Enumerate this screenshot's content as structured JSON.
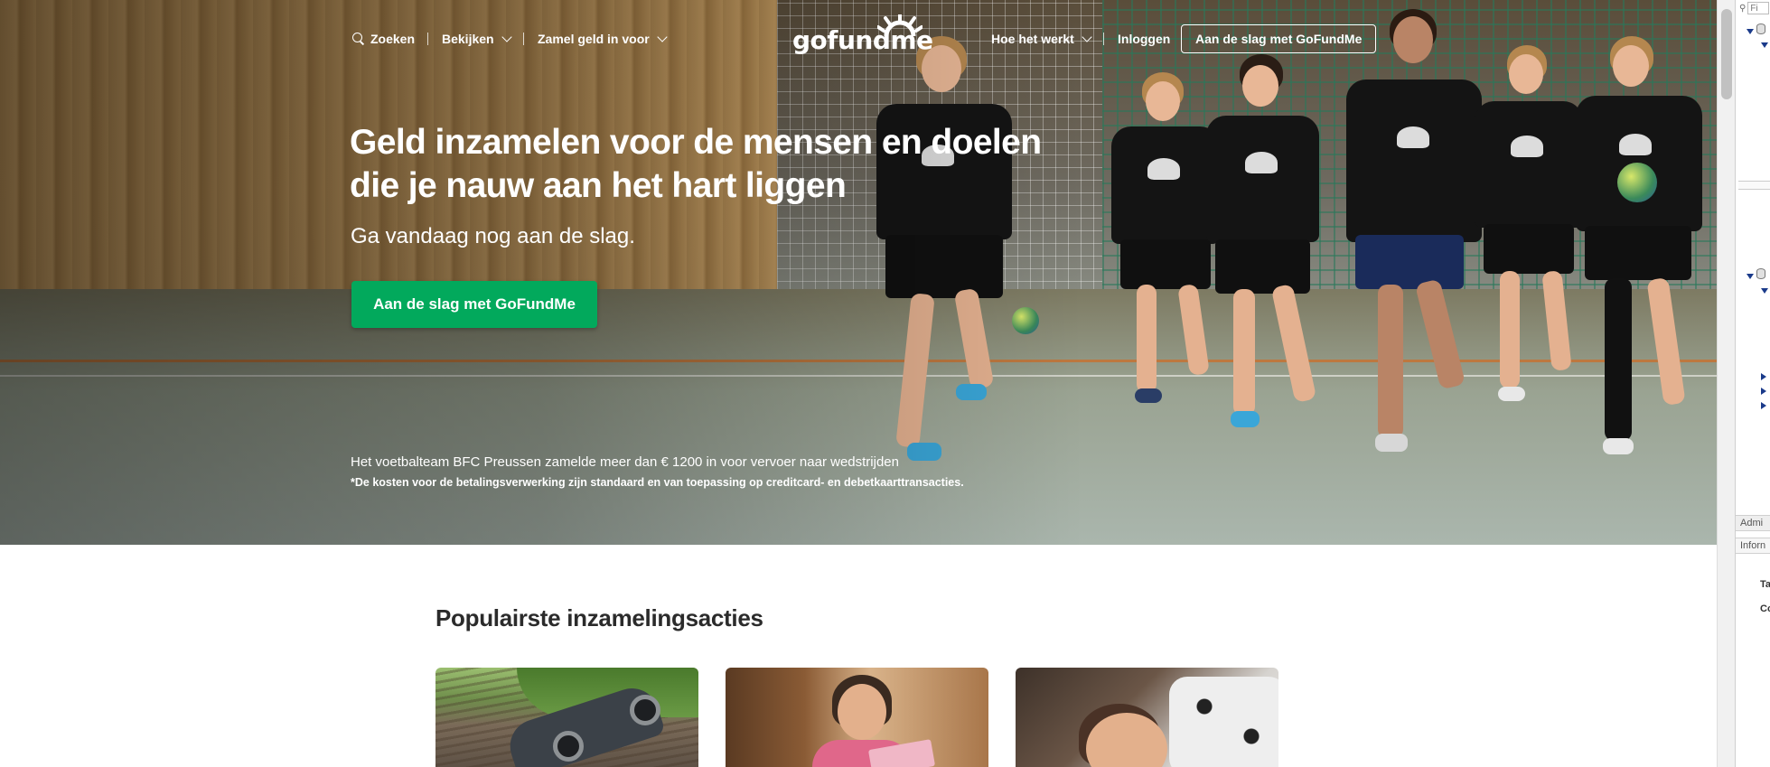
{
  "nav": {
    "search_label": "Zoeken",
    "browse_label": "Bekijken",
    "fundraise_label": "Zamel geld in voor",
    "logo_text": "gofundme",
    "how_it_works_label": "Hoe het werkt",
    "login_label": "Inloggen",
    "cta_label": "Aan de slag met GoFundMe"
  },
  "hero": {
    "title": "Geld inzamelen voor de mensen en doelen die je nauw aan het hart liggen",
    "subtitle": "Ga vandaag nog aan de slag.",
    "button_label": "Aan de slag met GoFundMe",
    "caption": "Het voetbalteam BFC Preussen zamelde meer dan € 1200 in voor vervoer naar wedstrijden",
    "note": "*De kosten voor de betalingsverwerking zijn standaard en van toepassing op creditcard- en debetkaarttransacties."
  },
  "popular": {
    "title": "Populairste inzamelingsacties"
  },
  "devtools": {
    "filter_placeholder": "Fi",
    "admin_label": "Admi",
    "info_label": "Inforn",
    "row_ta": "Ta",
    "row_co": "Co"
  },
  "colors": {
    "brand_green": "#02a95c",
    "heading_text": "#2b2b2b"
  }
}
